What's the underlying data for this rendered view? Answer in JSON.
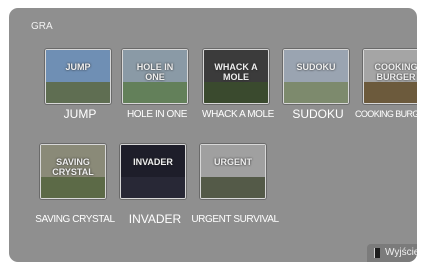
{
  "section": {
    "title": "GRA"
  },
  "games": [
    {
      "label": "JUMP",
      "art": "JUMP",
      "sky": "#6f8fb4",
      "ground": "#5f6e52"
    },
    {
      "label": "HOLE IN ONE",
      "art": "HOLE IN ONE",
      "sky": "#8a9aa6",
      "ground": "#63805a"
    },
    {
      "label": "WHACK A MOLE",
      "art": "WHACK A MOLE",
      "sky": "#3b3b3b",
      "ground": "#3a4a2e"
    },
    {
      "label": "SUDOKU",
      "art": "SUDOKU",
      "sky": "#9aa4b1",
      "ground": "#7d8a6d"
    },
    {
      "label": "COOKING BURGE",
      "art": "COOKING BURGER",
      "sky": "#a5a5a5",
      "ground": "#6c5a3c"
    },
    {
      "label": "SAVING CRYSTAL",
      "art": "SAVING CRYSTAL",
      "sky": "#8a8a78",
      "ground": "#5c6a47"
    },
    {
      "label": "INVADER",
      "art": "INVADER",
      "sky": "#1e1e2a",
      "ground": "#282836"
    },
    {
      "label": "URGENT SURVIVAL",
      "art": "URGENT",
      "sky": "#a0a0a0",
      "ground": "#545a48"
    }
  ],
  "exit": {
    "label": "Wyjście"
  }
}
